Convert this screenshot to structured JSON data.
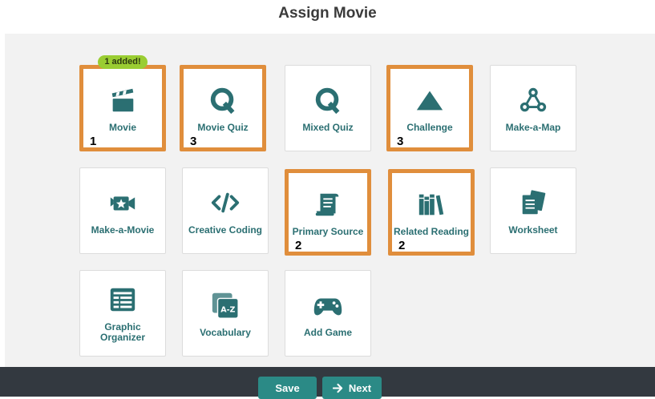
{
  "page": {
    "title": "Assign Movie"
  },
  "badge": {
    "text": "1 added!"
  },
  "colors": {
    "accent": "#2b8a86",
    "highlight": "#e08e3c",
    "icon": "#2b6f72",
    "badge": "#9acd32"
  },
  "tiles": [
    {
      "label": "Movie",
      "icon": "clapperboard-icon",
      "number": "1"
    },
    {
      "label": "Movie Quiz",
      "icon": "q-icon",
      "number": "3"
    },
    {
      "label": "Mixed Quiz",
      "icon": "q-icon",
      "number": ""
    },
    {
      "label": "Challenge",
      "icon": "mountain-icon",
      "number": "3"
    },
    {
      "label": "Make-a-Map",
      "icon": "map-nodes-icon",
      "number": ""
    },
    {
      "label": "Make-a-Movie",
      "icon": "camera-icon",
      "number": ""
    },
    {
      "label": "Creative Coding",
      "icon": "code-icon",
      "number": ""
    },
    {
      "label": "Primary Source",
      "icon": "scroll-icon",
      "number": "2"
    },
    {
      "label": "Related Reading",
      "icon": "books-icon",
      "number": "2"
    },
    {
      "label": "Worksheet",
      "icon": "worksheet-icon",
      "number": ""
    },
    {
      "label": "Graphic Organizer",
      "icon": "table-icon",
      "number": ""
    },
    {
      "label": "Vocabulary",
      "icon": "az-cards-icon",
      "number": ""
    },
    {
      "label": "Add Game",
      "icon": "gamepad-icon",
      "number": ""
    }
  ],
  "footer": {
    "save_label": "Save",
    "next_label": "Next",
    "next_icon": "arrow-right-icon"
  }
}
